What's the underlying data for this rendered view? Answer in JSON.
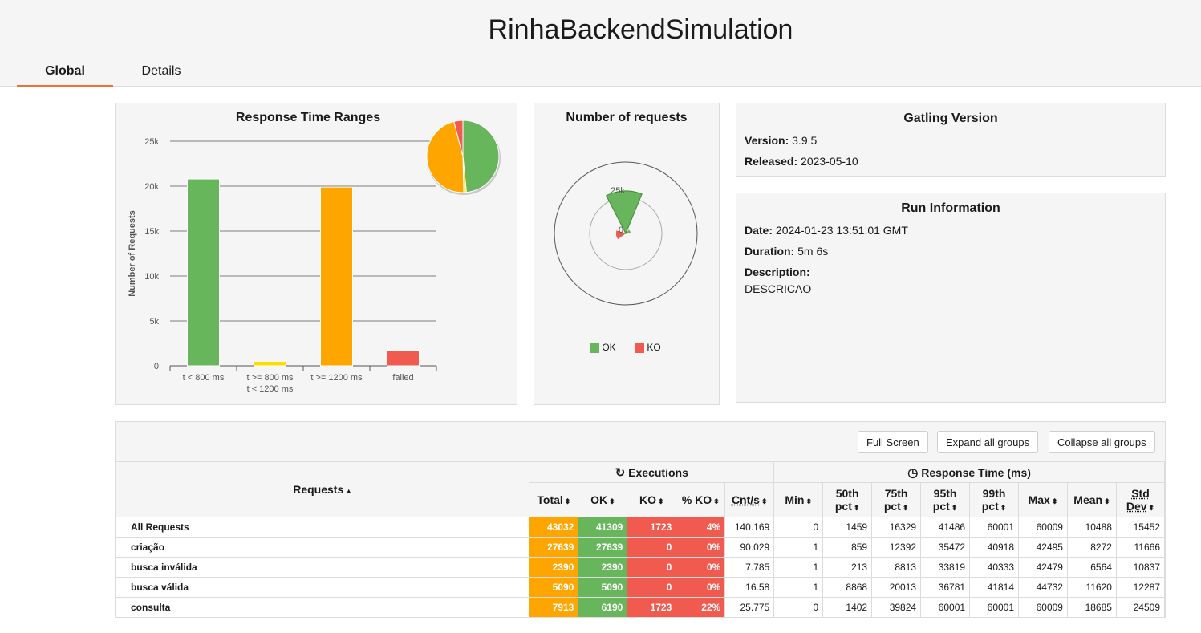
{
  "header": {
    "title": "RinhaBackendSimulation",
    "tabs": [
      {
        "label": "Global",
        "active": true
      },
      {
        "label": "Details",
        "active": false
      }
    ]
  },
  "colors": {
    "ok": "#68b65c",
    "ko": "#f15b4f",
    "orange": "#ffa500",
    "yellow": "#ffdd00"
  },
  "ranges_panel": {
    "title": "Response Time Ranges",
    "chart_data": {
      "type": "bar",
      "title": "Response Time Ranges",
      "ylabel": "Number of Requests",
      "ylim": [
        0,
        25000
      ],
      "y_ticks": [
        "0",
        "5k",
        "10k",
        "15k",
        "20k",
        "25k"
      ],
      "categories": [
        "t < 800 ms",
        "t >= 800 ms t < 1200 ms",
        "t >= 1200 ms",
        "failed"
      ],
      "category_lines": [
        [
          "t < 800 ms"
        ],
        [
          "t >= 800 ms",
          "t < 1200 ms"
        ],
        [
          "t >= 1200 ms"
        ],
        [
          "failed"
        ]
      ],
      "values": [
        20800,
        500,
        19900,
        1723
      ],
      "bar_colors": [
        "#68b65c",
        "#ffdd00",
        "#ffa500",
        "#f15b4f"
      ],
      "pie": [
        {
          "value": 20800,
          "color": "#68b65c"
        },
        {
          "value": 500,
          "color": "#ffdd00"
        },
        {
          "value": 19900,
          "color": "#ffa500"
        },
        {
          "value": 1723,
          "color": "#f15b4f"
        }
      ]
    }
  },
  "requests_panel": {
    "title": "Number of requests",
    "chart_data": {
      "type": "pie",
      "series": [
        {
          "name": "OK",
          "value": 41309,
          "color": "#68b65c"
        },
        {
          "name": "KO",
          "value": 1723,
          "color": "#f15b4f"
        }
      ],
      "ticks": [
        "25k",
        "0"
      ]
    },
    "legend": [
      {
        "label": "OK",
        "color": "#68b65c"
      },
      {
        "label": "KO",
        "color": "#f15b4f"
      }
    ]
  },
  "gatling": {
    "title": "Gatling Version",
    "version_label": "Version:",
    "version": "3.9.5",
    "released_label": "Released:",
    "released": "2023-05-10"
  },
  "run": {
    "title": "Run Information",
    "date_label": "Date:",
    "date": "2024-01-23 13:51:01 GMT",
    "duration_label": "Duration:",
    "duration": "5m 6s",
    "description_label": "Description:",
    "description": "DESCRICAO"
  },
  "toolbar": {
    "full_screen": "Full Screen",
    "expand_all": "Expand all groups",
    "collapse_all": "Collapse all groups"
  },
  "table": {
    "requests_header": "Requests",
    "executions_header": "Executions",
    "response_header": "Response Time (ms)",
    "columns": {
      "total": "Total",
      "ok": "OK",
      "ko": "KO",
      "pct_ko": "% KO",
      "cnt": "Cnt/s",
      "min": "Min",
      "p50a": "50th",
      "p50b": "pct",
      "p75a": "75th",
      "p75b": "pct",
      "p95a": "95th",
      "p95b": "pct",
      "p99a": "99th",
      "p99b": "pct",
      "max": "Max",
      "mean": "Mean",
      "stda": "Std",
      "stdb": "Dev"
    },
    "rows": [
      {
        "name": "All Requests",
        "total": "43032",
        "ok": "41309",
        "ko": "1723",
        "pct": "4%",
        "cnt": "140.169",
        "min": "0",
        "p50": "1459",
        "p75": "16329",
        "p95": "41486",
        "p99": "60001",
        "max": "60009",
        "mean": "10488",
        "std": "15452"
      },
      {
        "name": "criação",
        "total": "27639",
        "ok": "27639",
        "ko": "0",
        "pct": "0%",
        "cnt": "90.029",
        "min": "1",
        "p50": "859",
        "p75": "12392",
        "p95": "35472",
        "p99": "40918",
        "max": "42495",
        "mean": "8272",
        "std": "11666"
      },
      {
        "name": "busca inválida",
        "total": "2390",
        "ok": "2390",
        "ko": "0",
        "pct": "0%",
        "cnt": "7.785",
        "min": "1",
        "p50": "213",
        "p75": "8813",
        "p95": "33819",
        "p99": "40333",
        "max": "42479",
        "mean": "6564",
        "std": "10837"
      },
      {
        "name": "busca válida",
        "total": "5090",
        "ok": "5090",
        "ko": "0",
        "pct": "0%",
        "cnt": "16.58",
        "min": "1",
        "p50": "8868",
        "p75": "20013",
        "p95": "36781",
        "p99": "41814",
        "max": "44732",
        "mean": "11620",
        "std": "12287"
      },
      {
        "name": "consulta",
        "total": "7913",
        "ok": "6190",
        "ko": "1723",
        "pct": "22%",
        "cnt": "25.775",
        "min": "0",
        "p50": "1402",
        "p75": "39824",
        "p95": "60001",
        "p99": "60001",
        "max": "60009",
        "mean": "18685",
        "std": "24509"
      }
    ]
  }
}
